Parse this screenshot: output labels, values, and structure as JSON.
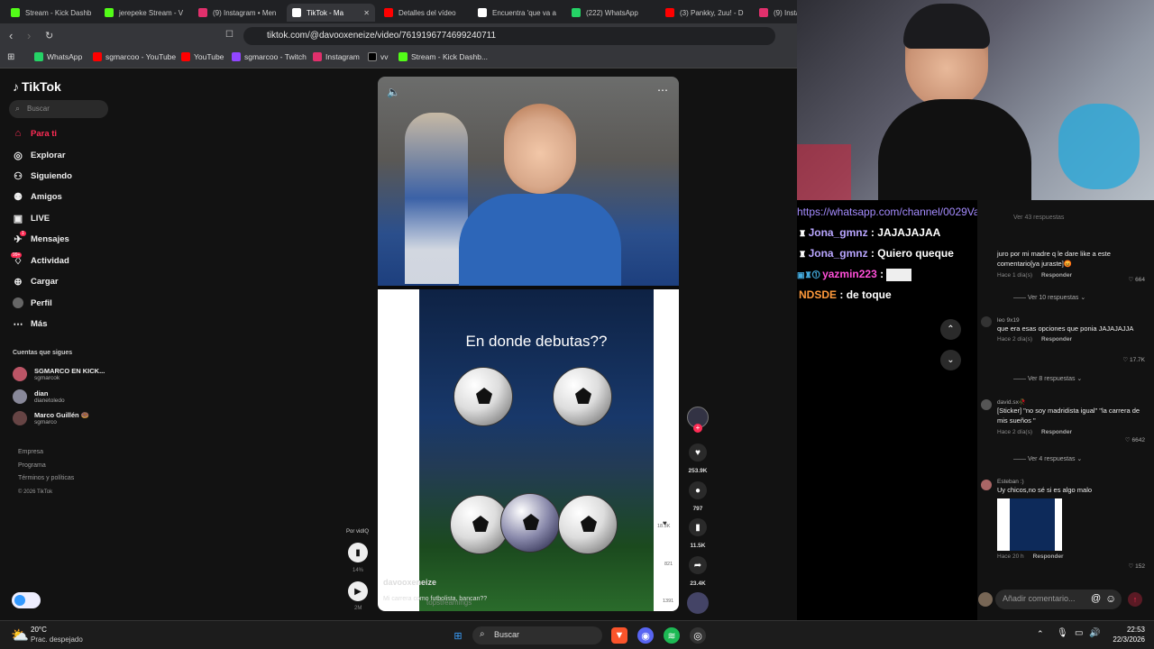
{
  "tabs": [
    {
      "label": "Stream - Kick Dashb",
      "color": "#53fc18"
    },
    {
      "label": "jerepeke Stream - V",
      "color": "#53fc18"
    },
    {
      "label": "(9) Instagram • Men",
      "color": "#e1306c"
    },
    {
      "label": "TikTok - Ma",
      "color": "#ffffff"
    },
    {
      "label": "Detalles del vídeo",
      "color": "#ff0000"
    },
    {
      "label": "Encuentra 'que va a",
      "color": "#ffffff"
    },
    {
      "label": "(222) WhatsApp",
      "color": "#25d366"
    },
    {
      "label": "(3) Pankky, 2uu! - D",
      "color": "#ff0000"
    },
    {
      "label": "(9) Instag",
      "color": "#e1306c"
    }
  ],
  "address": "tiktok.com/@davooxeneize/video/7619196774699240711",
  "bookmarks": [
    {
      "label": "WhatsApp",
      "color": "#25d366"
    },
    {
      "label": "sgmarcoo - YouTube",
      "color": "#ff0000"
    },
    {
      "label": "YouTube",
      "color": "#ff0000"
    },
    {
      "label": "sgmarcoo - Twitch",
      "color": "#9146ff"
    },
    {
      "label": "Instagram",
      "color": "#e1306c"
    },
    {
      "label": "vv",
      "color": "#000000"
    },
    {
      "label": "Stream - Kick Dashb...",
      "color": "#53fc18"
    }
  ],
  "tiktok": {
    "brand": "TikTok",
    "search_placeholder": "Buscar",
    "nav": [
      "Para ti",
      "Explorar",
      "Siguiendo",
      "Amigos",
      "LIVE",
      "Mensajes",
      "Actividad",
      "Cargar",
      "Perfil",
      "Más"
    ],
    "badge_messages": "1",
    "badge_activity": "99+",
    "following_title": "Cuentas que sigues",
    "following": [
      {
        "name": "SGMARCO EN KICK...",
        "handle": "sgmarcok"
      },
      {
        "name": "dian",
        "handle": "dianetoledo"
      },
      {
        "name": "Marco Guillén 🍩",
        "handle": "sgmarco"
      }
    ],
    "footer": [
      "Empresa",
      "Programa",
      "Términos y políticas",
      "© 2026 TikTok"
    ],
    "vidiq_label": "Por vidIQ",
    "vidiq_pct": "14%",
    "vidiq_time": "2M"
  },
  "video": {
    "title_text": "En donde debutas??",
    "author": "davooxeneize",
    "caption": "Mi carrera como futbolista, bancan??",
    "watermark": "topstreamings",
    "counts": {
      "likes": "253.9K",
      "comments": "797",
      "saves": "11.5K",
      "shares": "23.4K"
    },
    "inner_counts": [
      "18.3K",
      "821",
      "1391"
    ]
  },
  "chat": [
    {
      "user": "Jona_gmnz",
      "msg": "JAJAJAJAA",
      "color": "#b9a6ff"
    },
    {
      "user": "Jona_gmnz",
      "msg": "Quiero queque",
      "color": "#b9a6ff"
    },
    {
      "user": "yazmin223",
      "msg": "",
      "color": "#ff4fd8"
    },
    {
      "user": "NDSDE",
      "msg": "de toque",
      "color": "#ff9a3c"
    }
  ],
  "chat_link": "https://whatsapp.com/channel/0029VadyDcCHWxbEnUy1YP3x",
  "comments": {
    "top_partial": "Ver 43 respuestas",
    "items": [
      {
        "user": "",
        "text": "juro por mi madre q le dare like a este comentario[ya juraste]😡",
        "time": "Hace 1 día(s)",
        "reply": "Responder",
        "likes": "664",
        "replies": "Ver 10 respuestas"
      },
      {
        "user": "leo 9x19",
        "text": "que era esas opciones que ponia JAJAJAJJA",
        "time": "Hace 2 día(s)",
        "reply": "Responder",
        "likes": "17.7K",
        "replies": "Ver 8 respuestas"
      },
      {
        "user": "david.sx🥀",
        "text": "[Sticker] \"no soy madridista igual\" \"la carrera de mis sueños \"",
        "time": "Hace 2 día(s)",
        "reply": "Responder",
        "likes": "6642",
        "replies": "Ver 4 respuestas"
      },
      {
        "user": "Esteban :)",
        "text": "Uy chicos,no sé si es algo malo",
        "time": "Hace 20 h",
        "reply": "Responder",
        "likes": "152",
        "replies": ""
      }
    ],
    "input_placeholder": "Añadir comentario..."
  },
  "taskbar": {
    "weather_temp": "20°C",
    "weather_desc": "Prac. despejado",
    "search": "Buscar",
    "time": "22:53",
    "date": "22/3/2026"
  }
}
